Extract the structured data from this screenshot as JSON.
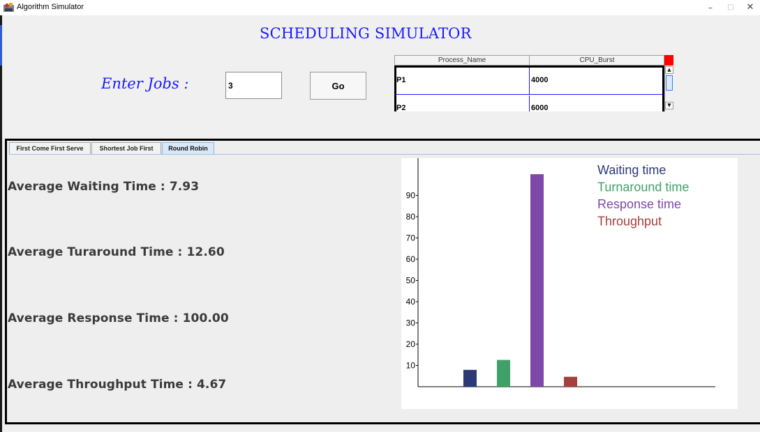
{
  "window": {
    "title": "Algorithm Simulator",
    "minimize": "–",
    "maximize": "□",
    "close": "✕"
  },
  "header": {
    "title": "SCHEDULING SIMULATOR",
    "enter_label": "Enter Jobs :",
    "jobs_value": "3",
    "go_label": "Go"
  },
  "process_table": {
    "columns": [
      "Process_Name",
      "CPU_Burst"
    ],
    "rows": [
      [
        "P1",
        "4000"
      ],
      [
        "P2",
        "6000"
      ]
    ],
    "corner_color": "#ff0000"
  },
  "tabs": [
    {
      "label": "First Come First Serve",
      "selected": false
    },
    {
      "label": "Shortest Job First",
      "selected": false
    },
    {
      "label": "Round Robin",
      "selected": true
    }
  ],
  "stats": {
    "waiting": "Average Waiting Time : 7.93",
    "turnaround": "Average Turaround Time : 12.60",
    "response": "Average Response Time : 100.00",
    "throughput": "Average Throughput Time : 4.67"
  },
  "chart_data": {
    "type": "bar",
    "categories": [
      "Waiting time",
      "Turnaround time",
      "Response time",
      "Throughput"
    ],
    "values": [
      7.93,
      12.6,
      100.0,
      4.67
    ],
    "colors": [
      "#2b3a77",
      "#3fa068",
      "#7e47a8",
      "#a4403d"
    ],
    "ylim": [
      0,
      100
    ],
    "yticks": [
      10,
      20,
      30,
      40,
      50,
      60,
      70,
      80,
      90
    ],
    "legend": "top-right",
    "grid": false
  }
}
